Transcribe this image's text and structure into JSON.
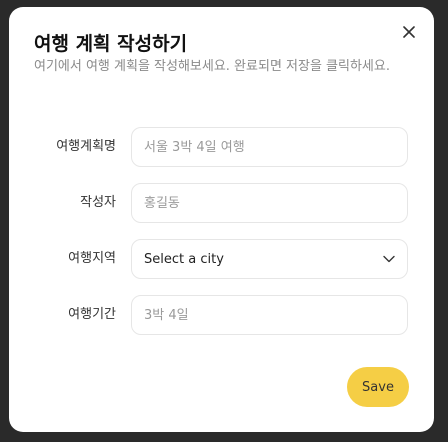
{
  "dialog": {
    "title": "여행 계획 작성하기",
    "description": "여기에서 여행 계획을 작성해보세요. 완료되면 저장을 클릭하세요.",
    "close_icon": "close-icon"
  },
  "form": {
    "plan_name": {
      "label": "여행계획명",
      "placeholder": "서울 3박 4일 여행",
      "value": ""
    },
    "author": {
      "label": "작성자",
      "placeholder": "홍길동",
      "value": ""
    },
    "region": {
      "label": "여행지역",
      "selected": "Select a city",
      "icon": "chevron-down-icon"
    },
    "duration": {
      "label": "여행기간",
      "placeholder": "3박 4일",
      "value": ""
    }
  },
  "actions": {
    "save_label": "Save"
  },
  "colors": {
    "accent": "#f5ce45",
    "dialog_bg": "#ffffff",
    "backdrop": "#2a2a2a"
  }
}
